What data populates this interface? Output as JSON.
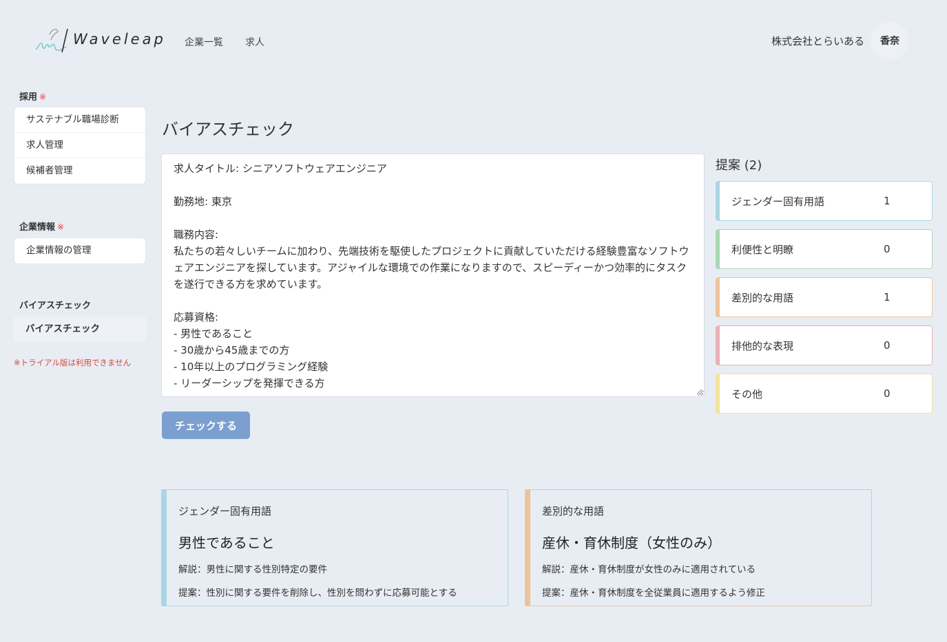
{
  "header": {
    "brand": "Waveleap",
    "nav": [
      "企業一覧",
      "求人"
    ],
    "company": "株式会社とらいある",
    "user": "香奈"
  },
  "sidebar": {
    "sections": [
      {
        "title": "採用",
        "required_mark": "※",
        "items": [
          "サステナブル職場診断",
          "求人管理",
          "候補者管理"
        ]
      },
      {
        "title": "企業情報",
        "required_mark": "※",
        "items": [
          "企業情報の管理"
        ]
      },
      {
        "title": "バイアスチェック",
        "items": [
          "バイアスチェック"
        ]
      }
    ],
    "trial_note": "※トライアル版は利用できません"
  },
  "main": {
    "title": "バイアスチェック",
    "editor_text": "求人タイトル: シニアソフトウェアエンジニア\n\n勤務地: 東京\n\n職務内容:\n私たちの若々しいチームに加わり、先端技術を駆使したプロジェクトに貢献していただける経験豊富なソフトウェアエンジニアを探しています。アジャイルな環境での作業になりますので、スピーディーかつ効率的にタスクを遂行できる方を求めています。\n\n応募資格:\n- 男性であること\n- 30歳から45歳までの方\n- 10年以上のプログラミング経験\n- リーダーシップを発揮できる方",
    "check_button": "チェックする"
  },
  "proposals": {
    "title": "提案 (2)",
    "items": [
      {
        "label": "ジェンダー固有用語",
        "count": "1",
        "color": "#a9d6e3"
      },
      {
        "label": "利便性と明瞭",
        "count": "0",
        "color": "#a8d9b2"
      },
      {
        "label": "差別的な用語",
        "count": "1",
        "color": "#efc39a"
      },
      {
        "label": "排他的な表現",
        "count": "0",
        "color": "#eab0b4"
      },
      {
        "label": "その他",
        "count": "0",
        "color": "#f1e39a"
      }
    ]
  },
  "results": [
    {
      "category": "ジェンダー固有用語",
      "term": "男性であること",
      "explanation": "解説：男性に関する性別特定の要件",
      "suggestion": "提案：性別に関する要件を削除し、性別を問わずに応募可能とする",
      "color": "#a9d6e3"
    },
    {
      "category": "差別的な用語",
      "term": "産休・育休制度（女性のみ）",
      "explanation": "解説：産休・育休制度が女性のみに適用されている",
      "suggestion": "提案：産休・育休制度を全従業員に適用するよう修正",
      "color": "#efc39a"
    }
  ]
}
